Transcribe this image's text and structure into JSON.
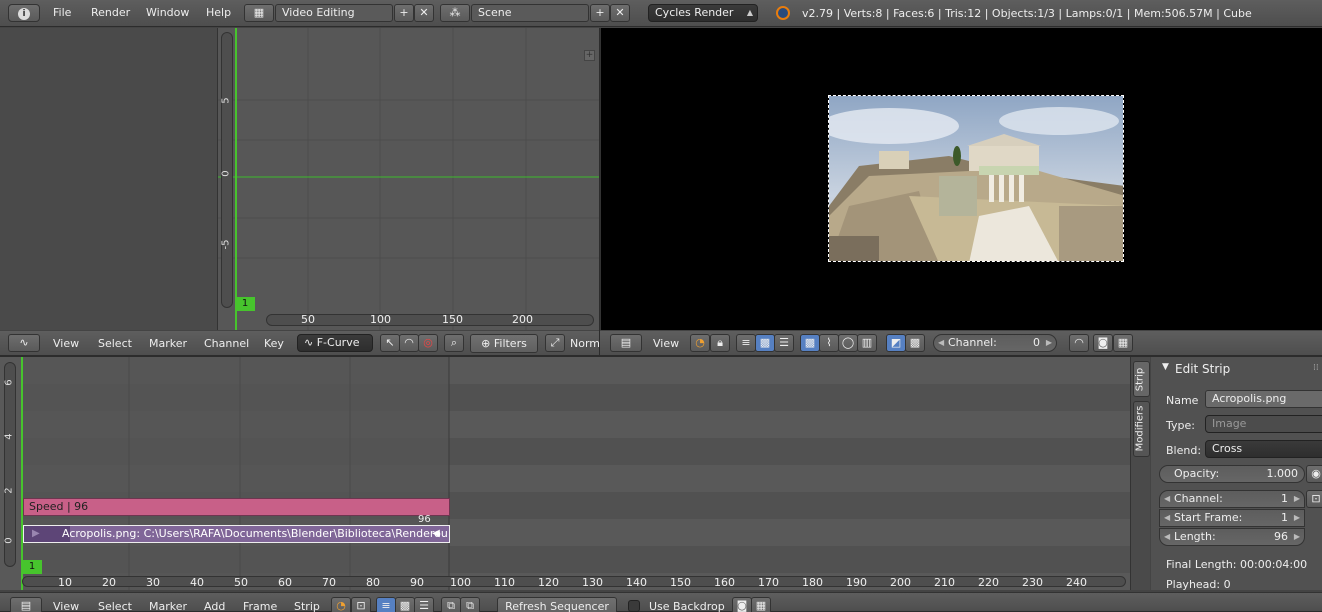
{
  "top_bar": {
    "menus": [
      "File",
      "Render",
      "Window",
      "Help"
    ],
    "screen_layout": "Video Editing",
    "scene": "Scene",
    "render_engine": "Cycles Render",
    "stats": "v2.79 | Verts:8 | Faces:6 | Tris:12 | Objects:1/3 | Lamps:0/1 | Mem:506.57M | Cube"
  },
  "graph_editor": {
    "y_ticks": [
      "5",
      "0",
      "-5"
    ],
    "x_ticks": [
      "50",
      "100",
      "150",
      "200"
    ],
    "current_frame": "1",
    "menus": [
      "View",
      "Select",
      "Marker",
      "Channel",
      "Key"
    ],
    "mode": "F-Curve",
    "filters_label": "Filters",
    "normalize_label": "Norm"
  },
  "preview": {
    "menus": [
      "View"
    ],
    "channel_label": "Channel:",
    "channel_value": "0"
  },
  "sequencer": {
    "y_ticks": [
      "6",
      "4",
      "2",
      "0"
    ],
    "x_ticks": [
      "10",
      "20",
      "30",
      "40",
      "50",
      "60",
      "70",
      "80",
      "90",
      "100",
      "110",
      "120",
      "130",
      "140",
      "150",
      "160",
      "170",
      "180",
      "190",
      "200",
      "210",
      "220",
      "230",
      "240"
    ],
    "current_frame": "1",
    "speed_strip": "Speed | 96",
    "image_strip": "Acropolis.png: C:\\Users\\RAFA\\Documents\\Blender\\Biblioteca\\Renderou",
    "strip_end_frame": "96",
    "menus": [
      "View",
      "Select",
      "Marker",
      "Add",
      "Frame",
      "Strip"
    ],
    "refresh_label": "Refresh Sequencer",
    "backdrop_label": "Use Backdrop"
  },
  "properties": {
    "tabs": [
      "Strip",
      "Modifiers"
    ],
    "panel_title": "Edit Strip",
    "name_label": "Name",
    "name_value": "Acropolis.png",
    "type_label": "Type:",
    "type_value": "Image",
    "blend_label": "Blend:",
    "blend_value": "Cross",
    "opacity_label": "Opacity:",
    "opacity_value": "1.000",
    "channel_label": "Channel:",
    "channel_value": "1",
    "start_label": "Start Frame:",
    "start_value": "1",
    "length_label": "Length:",
    "length_value": "96",
    "final_length": "Final Length: 00:00:04:00",
    "playhead": "Playhead: 0"
  }
}
